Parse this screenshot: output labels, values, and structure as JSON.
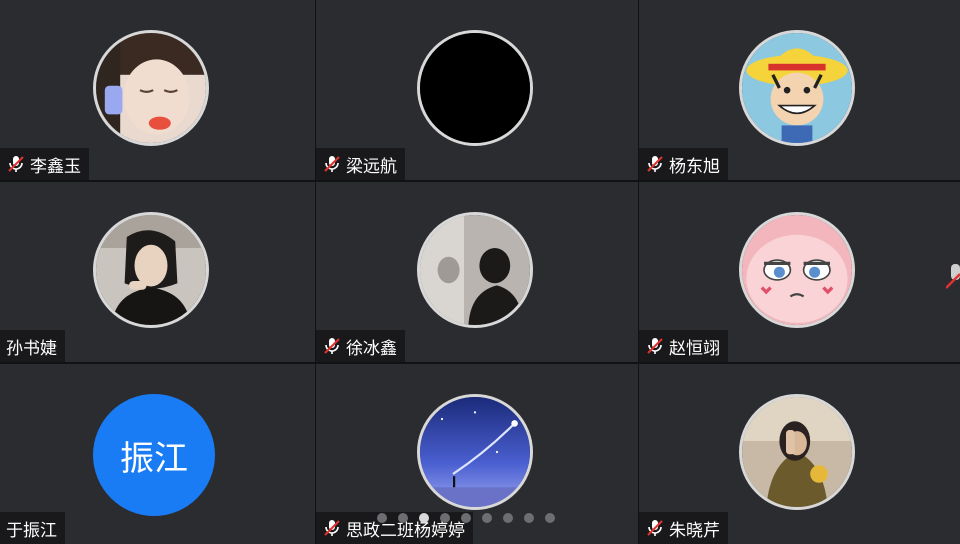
{
  "participants": [
    {
      "name": "李鑫玉",
      "muted": true,
      "avatar": "photo-girl-icon"
    },
    {
      "name": "梁远航",
      "muted": true,
      "avatar": "black-avatar-icon"
    },
    {
      "name": "杨东旭",
      "muted": true,
      "avatar": "cartoon-straw-hat-icon"
    },
    {
      "name": "孙书婕",
      "muted": false,
      "avatar": "photo-woman-icon"
    },
    {
      "name": "徐冰鑫",
      "muted": true,
      "avatar": "photo-silhouette-icon"
    },
    {
      "name": "赵恒翊",
      "muted": true,
      "avatar": "cartoon-pink-face-icon"
    },
    {
      "name": "于振江",
      "muted": false,
      "avatar": "text-avatar",
      "avatar_text": "振江",
      "avatar_color": "#1a7cf4"
    },
    {
      "name": "思政二班杨婷婷",
      "muted": true,
      "avatar": "starry-sky-icon"
    },
    {
      "name": "朱晓芹",
      "muted": true,
      "avatar": "photo-hands-icon"
    }
  ],
  "pagination": {
    "pages": 9,
    "current": 3
  },
  "colors": {
    "tile": "#2b2c2f",
    "mute_red": "#e0322f",
    "accent": "#1a7cf4"
  }
}
